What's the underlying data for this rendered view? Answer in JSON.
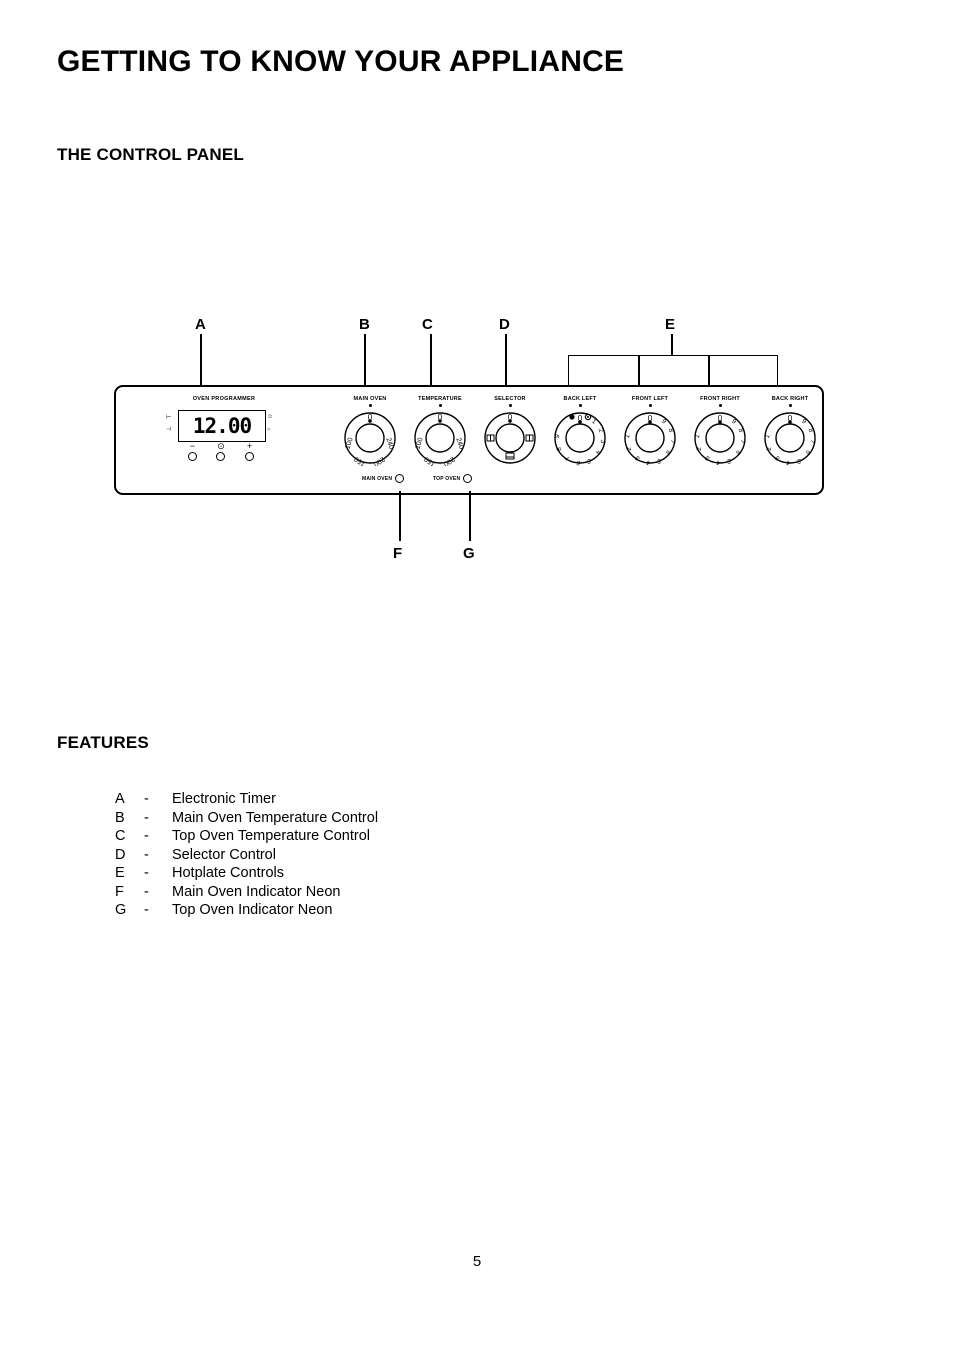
{
  "document": {
    "title": "GETTING TO KNOW YOUR APPLIANCE",
    "section_control_panel": "THE CONTROL PANEL",
    "section_features": "FEATURES",
    "page_number": "5"
  },
  "callouts": [
    {
      "letter": "A",
      "target": "Electronic Timer"
    },
    {
      "letter": "B",
      "target": "Main Oven Temperature Control"
    },
    {
      "letter": "C",
      "target": "Top Oven Temperature Control"
    },
    {
      "letter": "D",
      "target": "Selector Control"
    },
    {
      "letter": "E",
      "target": "Hotplate Controls"
    },
    {
      "letter": "F",
      "target": "Main Oven Indicator Neon"
    },
    {
      "letter": "G",
      "target": "Top Oven Indicator Neon"
    }
  ],
  "control_panel": {
    "programmer": {
      "label": "OVEN PROGRAMMER",
      "display_value": "12.00",
      "left_icons": [
        "cook-start-icon",
        "cook-end-icon"
      ],
      "right_icons": [
        "bell-icon",
        "clock-icon"
      ],
      "buttons": [
        {
          "symbol": "−",
          "name": "minus-button"
        },
        {
          "symbol": "⊙",
          "name": "clock-button"
        },
        {
          "symbol": "+",
          "name": "plus-button"
        }
      ]
    },
    "knobs": [
      {
        "label": "MAIN OVEN",
        "type": "temperature",
        "markings": [
          "0",
          "240",
          "200",
          "150",
          "100"
        ]
      },
      {
        "label": "TEMPERATURE",
        "type": "temperature",
        "markings": [
          "0",
          "240",
          "200",
          "150",
          "100"
        ]
      },
      {
        "label": "SELECTOR",
        "type": "selector",
        "markings": [
          "0"
        ],
        "icons": [
          "grill-left-icon",
          "grill-right-icon",
          "oven-icon"
        ]
      },
      {
        "label": "BACK LEFT",
        "type": "hotplate-dual",
        "markings": [
          "0",
          "1",
          "2",
          "3",
          "4",
          "5",
          "6",
          "7",
          "8",
          "9"
        ]
      },
      {
        "label": "FRONT LEFT",
        "type": "hotplate",
        "markings": [
          "0",
          "1",
          "2",
          "3",
          "4",
          "5",
          "6",
          "7",
          "8",
          "9"
        ]
      },
      {
        "label": "FRONT RIGHT",
        "type": "hotplate",
        "markings": [
          "0",
          "1",
          "2",
          "3",
          "4",
          "5",
          "6",
          "7",
          "8",
          "9"
        ]
      },
      {
        "label": "BACK RIGHT",
        "type": "hotplate",
        "markings": [
          "0",
          "1",
          "2",
          "3",
          "4",
          "5",
          "6",
          "7",
          "8",
          "9"
        ]
      }
    ],
    "neons": [
      {
        "label": "MAIN OVEN"
      },
      {
        "label": "TOP OVEN"
      }
    ]
  },
  "features": [
    {
      "key": "A",
      "dash": "-",
      "description": "Electronic Timer"
    },
    {
      "key": "B",
      "dash": "-",
      "description": "Main Oven Temperature Control"
    },
    {
      "key": "C",
      "dash": "-",
      "description": "Top Oven Temperature Control"
    },
    {
      "key": "D",
      "dash": "-",
      "description": "Selector Control"
    },
    {
      "key": "E",
      "dash": "-",
      "description": "Hotplate Controls"
    },
    {
      "key": "F",
      "dash": "-",
      "description": "Main Oven Indicator Neon"
    },
    {
      "key": "G",
      "dash": "-",
      "description": "Top Oven Indicator Neon"
    }
  ]
}
